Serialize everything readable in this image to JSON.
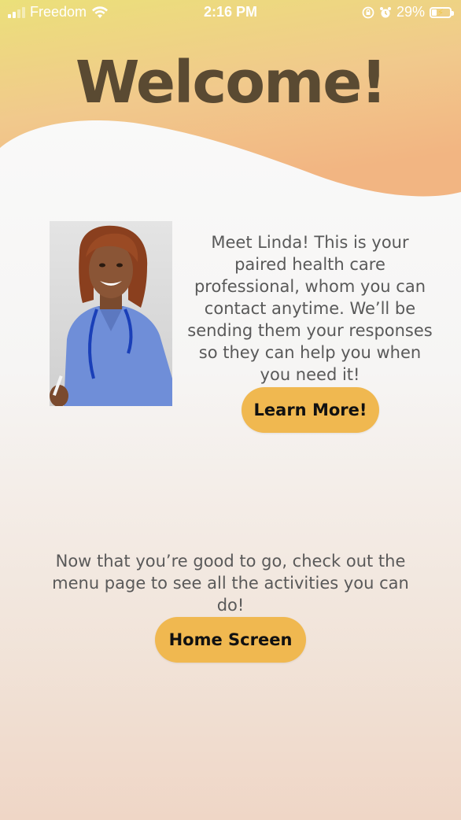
{
  "status_bar": {
    "carrier": "Freedom",
    "time": "2:16 PM",
    "battery_percent": "29%",
    "battery_level": 0.29,
    "icons": [
      "signal-icon",
      "wifi-icon",
      "orientation-lock-icon",
      "alarm-icon",
      "battery-charging-icon"
    ]
  },
  "header": {
    "title": "Welcome!",
    "gradient_top": "#ebe07a",
    "gradient_bottom": "#f2b582"
  },
  "professional": {
    "photo_alt": "healthcare-professional-photo",
    "intro_text": "Meet Linda! This is your paired health care professional, whom you can contact anytime. We’ll be sending them your responses so they can help you when you need it!",
    "learn_more_label": "Learn More!"
  },
  "next_steps": {
    "text": "Now that you’re good to go, check out the menu page to see all the activities you can do!",
    "home_button_label": "Home Screen"
  },
  "colors": {
    "accent_button": "#f0b850",
    "title_color": "#5a4a32",
    "body_text": "#595959"
  }
}
